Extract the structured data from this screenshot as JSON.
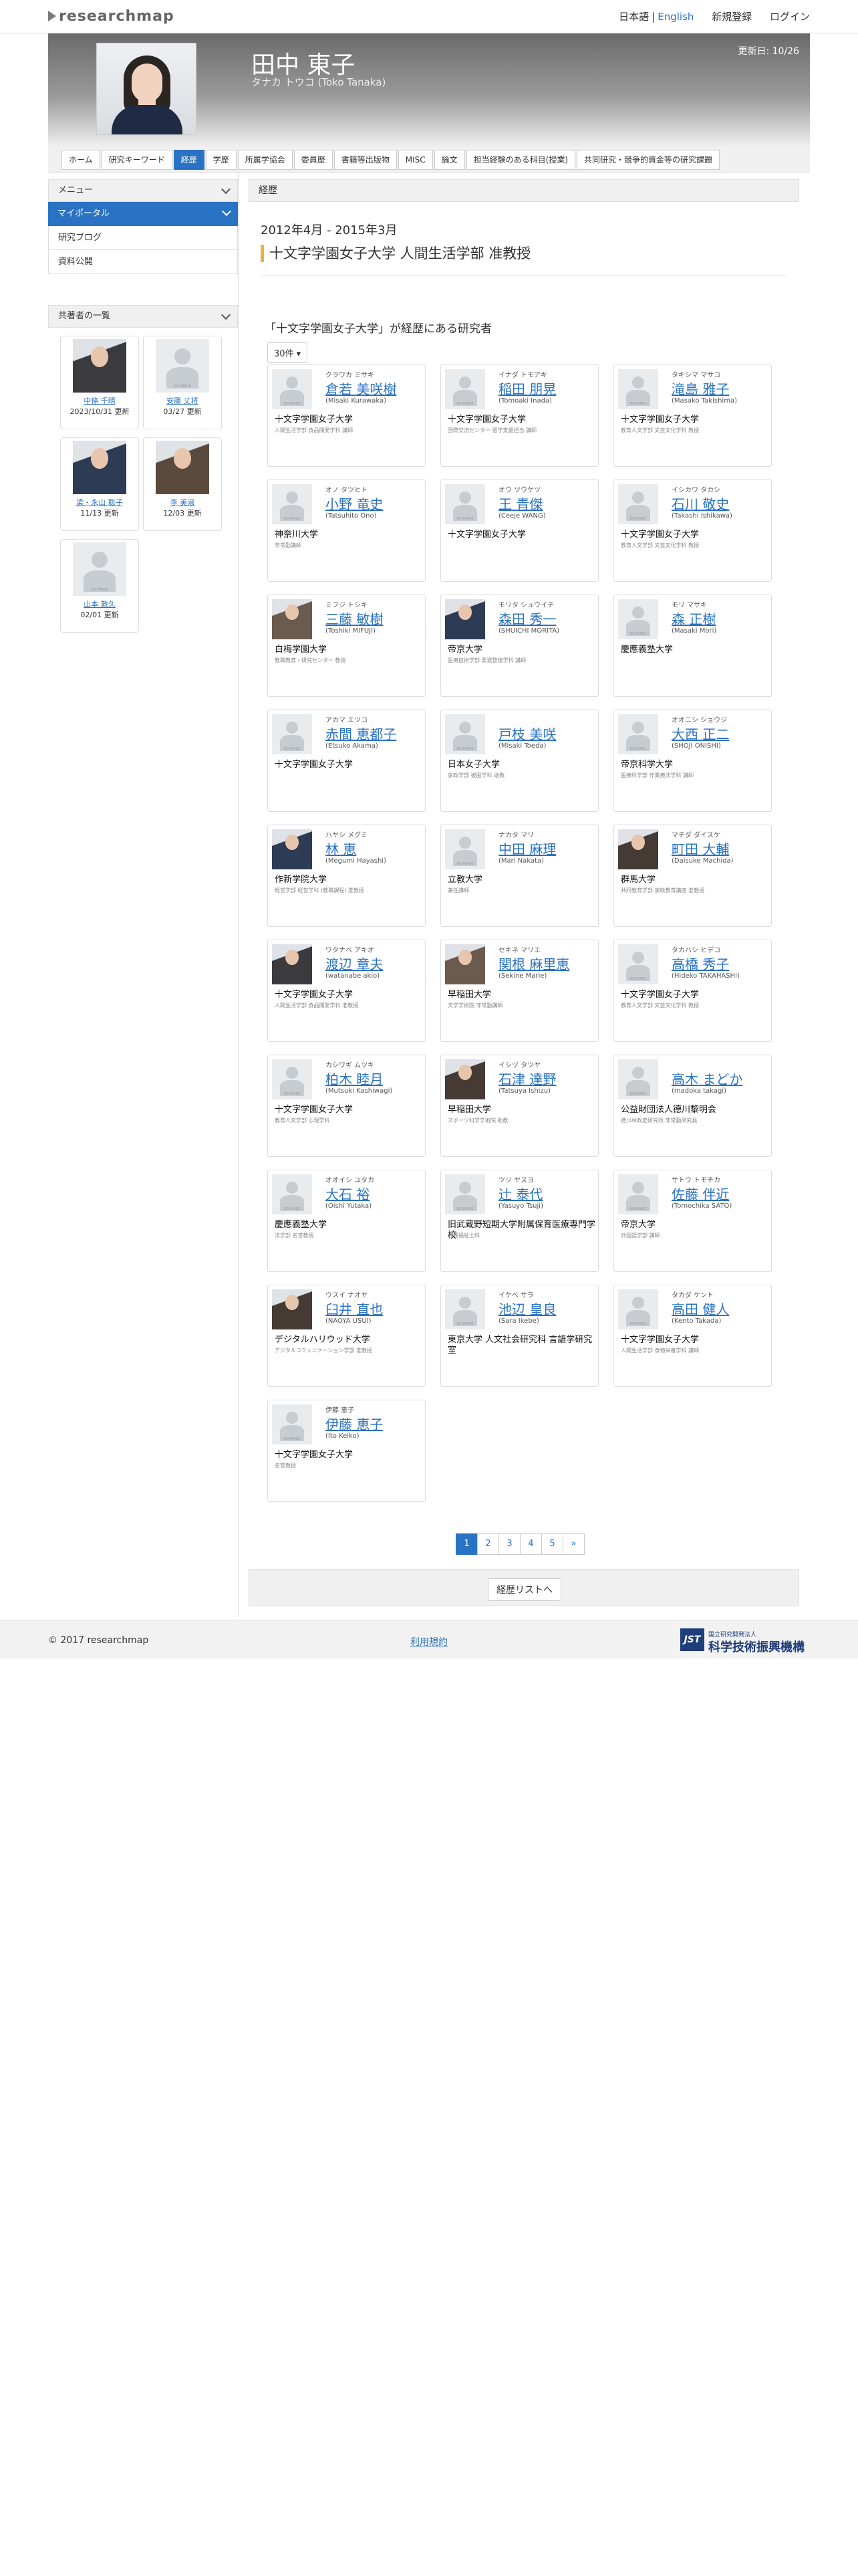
{
  "topbar": {
    "logo": "researchmap",
    "lang_ja": "日本語",
    "lang_sep": "|",
    "lang_en": "English",
    "signup": "新規登録",
    "login": "ログイン"
  },
  "header": {
    "name": "田中 東子",
    "kana": "タナカ トウコ  (Toko Tanaka)",
    "updated": "更新日: 10/26"
  },
  "tabs": [
    "ホーム",
    "研究キーワード",
    "経歴",
    "学歴",
    "所属学協会",
    "委員歴",
    "書籍等出版物",
    "MISC",
    "論文",
    "担当経験のある科目(授業)",
    "共同研究・競争的資金等の研究課題"
  ],
  "active_tab": "経歴",
  "sidebar": {
    "menu": "メニュー",
    "portal": "マイポータル",
    "items": [
      "研究ブログ",
      "資料公開"
    ],
    "coauthors_title": "共著者の一覧",
    "coauthors": [
      {
        "name": "中條 千晴",
        "updated": "2023/10/31 更新",
        "photo": true
      },
      {
        "name": "安藤 丈将",
        "updated": "03/27 更新",
        "photo": false
      },
      {
        "name": "梁・永山 聡子",
        "updated": "11/13 更新",
        "photo": true
      },
      {
        "name": "李 美淑",
        "updated": "12/03 更新",
        "photo": true
      },
      {
        "name": "山本 敦久",
        "updated": "02/01 更新",
        "photo": false
      }
    ]
  },
  "main": {
    "heading": "経歴",
    "period": "2012年4月 - 2015年3月",
    "title": "十文字学園女子大学 人間生活学部 准教授",
    "related_heading": "「十文字学園女子大学」が経歴にある研究者",
    "per_page": "30件 ▾",
    "noimage": "NO IMAGE"
  },
  "researchers": [
    {
      "kana": "クラワカ ミサキ",
      "name": "倉若 美咲樹",
      "roman": "(Misaki Kurawaka)",
      "aff": "十文字学園女子大学",
      "dept": "人間生活学部 食品開発学科 講師",
      "photo": false
    },
    {
      "kana": "イナダ トモアキ",
      "name": "稲田 朋晃",
      "roman": "(Tomoaki Inada)",
      "aff": "十文字学園女子大学",
      "dept": "国際交流センター 留学支援担当 講師",
      "photo": false
    },
    {
      "kana": "タキシマ マサコ",
      "name": "滝島 雅子",
      "roman": "(Masako Takishima)",
      "aff": "十文字学園女子大学",
      "dept": "教育人文学部 文芸文化学科 教授",
      "photo": false
    },
    {
      "kana": "オノ タツヒト",
      "name": "小野 竜史",
      "roman": "(Tatsuhito Ono)",
      "aff": "神奈川大学",
      "dept": "非常勤講師",
      "photo": false
    },
    {
      "kana": "オウ ツウケツ",
      "name": "王 青傑",
      "roman": "(Ceeje WANG)",
      "aff": "十文字学園女子大学",
      "dept": "",
      "photo": false
    },
    {
      "kana": "イシカワ タカシ",
      "name": "石川 敬史",
      "roman": "(Takashi Ishikawa)",
      "aff": "十文字学園女子大学",
      "dept": "教育人文学部 文芸文化学科 教授",
      "photo": false
    },
    {
      "kana": "ミフジ トシキ",
      "name": "三藤 敏樹",
      "roman": "(Toshiki MIFUJI)",
      "aff": "白梅学園大学",
      "dept": "教職教育・研究センター 教授",
      "photo": true
    },
    {
      "kana": "モリタ シュウイチ",
      "name": "森田 秀一",
      "roman": "(SHUICHI MORITA)",
      "aff": "帝京大学",
      "dept": "医療技術学部 柔道整復学科 講師",
      "photo": true
    },
    {
      "kana": "モリ マサキ",
      "name": "森 正樹",
      "roman": "(Masaki Mori)",
      "aff": "慶應義塾大学",
      "dept": "",
      "photo": false
    },
    {
      "kana": "アカマ エツコ",
      "name": "赤間 恵都子",
      "roman": "(Etsuko Akama)",
      "aff": "十文字学園女子大学",
      "dept": "",
      "photo": false
    },
    {
      "kana": "",
      "name": "戸枝 美咲",
      "roman": "(Misaki Toeda)",
      "aff": "日本女子大学",
      "dept": "家政学部 被服学科 助教",
      "photo": false
    },
    {
      "kana": "オオニシ ショウジ",
      "name": "大西 正二",
      "roman": "(SHOJI ONISHI)",
      "aff": "帝京科学大学",
      "dept": "医療科学部 作業療法学科 講師",
      "photo": false
    },
    {
      "kana": "ハヤシ メグミ",
      "name": "林 恵",
      "roman": "(Megumi Hayashi)",
      "aff": "作新学院大学",
      "dept": "経営学部 経営学科 (教職課程) 准教授",
      "photo": true
    },
    {
      "kana": "ナカタ マリ",
      "name": "中田 麻理",
      "roman": "(Mari Nakata)",
      "aff": "立教大学",
      "dept": "兼任講師",
      "photo": false
    },
    {
      "kana": "マチダ ダイスケ",
      "name": "町田 大輔",
      "roman": "(Daisuke Machida)",
      "aff": "群馬大学",
      "dept": "共同教育学部 家政教育講座 准教授",
      "photo": true
    },
    {
      "kana": "ワタナベ アキオ",
      "name": "渡辺 章夫",
      "roman": "(watanabe akio)",
      "aff": "十文字学園女子大学",
      "dept": "人間生活学部 食品開発学科 准教授",
      "photo": true
    },
    {
      "kana": "セキネ マリエ",
      "name": "関根 麻里恵",
      "roman": "(Sekine Marie)",
      "aff": "早稲田大学",
      "dept": "文学学術院 非常勤講師",
      "photo": true
    },
    {
      "kana": "タカハシ ヒデコ",
      "name": "高橋 秀子",
      "roman": "(Hideko TAKAHASHI)",
      "aff": "十文字学園女子大学",
      "dept": "教育人文学部 文芸文化学科 教授",
      "photo": false
    },
    {
      "kana": "カシワギ ムツキ",
      "name": "柏木 睦月",
      "roman": "(Mutsuki Kashiwagi)",
      "aff": "十文字学園女子大学",
      "dept": "教育人文学部 心理学科",
      "photo": false
    },
    {
      "kana": "イシヅ タツヤ",
      "name": "石津 達野",
      "roman": "(Tatsuya Ishizu)",
      "aff": "早稲田大学",
      "dept": "スポーツ科学学術院 助教",
      "photo": true
    },
    {
      "kana": "",
      "name": "高木 まどか",
      "roman": "(madoka takagi)",
      "aff": "公益財団法人德川黎明会",
      "dept": "德川林政史研究所 非常勤研究員",
      "photo": false
    },
    {
      "kana": "オオイシ ユタカ",
      "name": "大石 裕",
      "roman": "(Oishi Yutaka)",
      "aff": "慶應義塾大学",
      "dept": "法学部 名誉教授",
      "photo": false
    },
    {
      "kana": "ツジ ヤスヨ",
      "name": "辻 泰代",
      "roman": "(Yasuyo Tsuji)",
      "aff": "旧武蔵野短期大学附属保育医療専門学校",
      "dept": "介護福祉士科",
      "photo": false
    },
    {
      "kana": "サトウ トモチカ",
      "name": "佐藤 伴近",
      "roman": "(Tomochika SATO)",
      "aff": "帝京大学",
      "dept": "外国語学部 講師",
      "photo": false
    },
    {
      "kana": "ウスイ ナオヤ",
      "name": "臼井 直也",
      "roman": "(NAOYA USUI)",
      "aff": "デジタルハリウッド大学",
      "dept": "デジタルコミュニケーション学部 准教授",
      "photo": true
    },
    {
      "kana": "イケベ サラ",
      "name": "池辺 皇良",
      "roman": "(Sara Ikebe)",
      "aff": "東京大学 人文社会研究科 言語学研究室",
      "dept": "",
      "photo": false
    },
    {
      "kana": "タカダ ケント",
      "name": "高田 健人",
      "roman": "(Kento Takada)",
      "aff": "十文字学園女子大学",
      "dept": "人間生活学部 食物栄養学科 講師",
      "photo": false
    },
    {
      "kana": "伊藤 恵子",
      "name": "伊藤 恵子",
      "roman": "(Ito Keiko)",
      "aff": "十文字学園女子大学",
      "dept": "名誉教授",
      "photo": false
    }
  ],
  "pagination": [
    "1",
    "2",
    "3",
    "4",
    "5",
    "»"
  ],
  "list_button": "経歴リストへ",
  "footer": {
    "copyright": "© 2017 researchmap",
    "terms": "利用規約",
    "jst_small": "国立研究開発法人",
    "jst_large": "科学技術振興機構",
    "jst_logo": "JST"
  },
  "colors": {
    "accent": "#2a72c3",
    "title_bar": "#e8b33f"
  }
}
